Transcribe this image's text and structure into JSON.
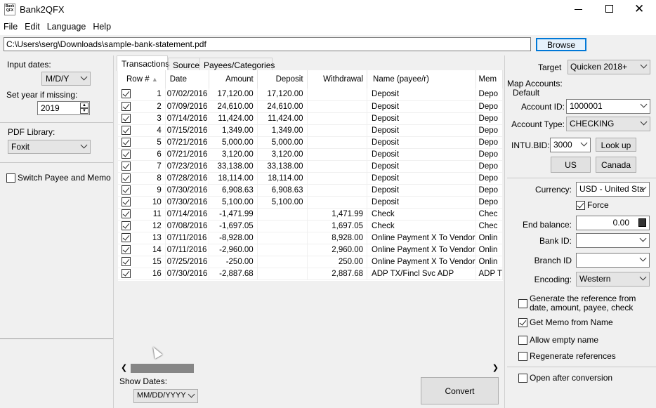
{
  "window": {
    "title": "Bank2QFX",
    "app_icon_text": "Bank QFX"
  },
  "menu": [
    "File",
    "Edit",
    "Language",
    "Help"
  ],
  "file_path": "C:\\Users\\serg\\Downloads\\sample-bank-statement.pdf",
  "browse_label": "Browse",
  "left": {
    "input_dates_label": "Input dates:",
    "input_dates_value": "M/D/Y",
    "set_year_label": "Set year if missing:",
    "year_value": "2019",
    "pdf_library_label": "PDF Library:",
    "pdf_library_value": "Foxit",
    "switch_label": "Switch Payee and Memo"
  },
  "tabs": [
    "Transactions",
    "Source",
    "Payees/Categories"
  ],
  "columns": [
    "Row #",
    "Date",
    "Amount",
    "Deposit",
    "Withdrawal",
    "Name (payee/r)",
    "Mem"
  ],
  "rows": [
    {
      "n": "1",
      "date": "07/02/2016",
      "amount": "17,120.00",
      "deposit": "17,120.00",
      "withdrawal": "",
      "name": "Deposit",
      "memo": "Depo"
    },
    {
      "n": "2",
      "date": "07/09/2016",
      "amount": "24,610.00",
      "deposit": "24,610.00",
      "withdrawal": "",
      "name": "Deposit",
      "memo": "Depo"
    },
    {
      "n": "3",
      "date": "07/14/2016",
      "amount": "11,424.00",
      "deposit": "11,424.00",
      "withdrawal": "",
      "name": "Deposit",
      "memo": "Depo"
    },
    {
      "n": "4",
      "date": "07/15/2016",
      "amount": "1,349.00",
      "deposit": "1,349.00",
      "withdrawal": "",
      "name": "Deposit",
      "memo": "Depo"
    },
    {
      "n": "5",
      "date": "07/21/2016",
      "amount": "5,000.00",
      "deposit": "5,000.00",
      "withdrawal": "",
      "name": "Deposit",
      "memo": "Depo"
    },
    {
      "n": "6",
      "date": "07/21/2016",
      "amount": "3,120.00",
      "deposit": "3,120.00",
      "withdrawal": "",
      "name": "Deposit",
      "memo": "Depo"
    },
    {
      "n": "7",
      "date": "07/23/2016",
      "amount": "33,138.00",
      "deposit": "33,138.00",
      "withdrawal": "",
      "name": "Deposit",
      "memo": "Depo"
    },
    {
      "n": "8",
      "date": "07/28/2016",
      "amount": "18,114.00",
      "deposit": "18,114.00",
      "withdrawal": "",
      "name": "Deposit",
      "memo": "Depo"
    },
    {
      "n": "9",
      "date": "07/30/2016",
      "amount": "6,908.63",
      "deposit": "6,908.63",
      "withdrawal": "",
      "name": "Deposit",
      "memo": "Depo"
    },
    {
      "n": "10",
      "date": "07/30/2016",
      "amount": "5,100.00",
      "deposit": "5,100.00",
      "withdrawal": "",
      "name": "Deposit",
      "memo": "Depo"
    },
    {
      "n": "11",
      "date": "07/14/2016",
      "amount": "-1,471.99",
      "deposit": "",
      "withdrawal": "1,471.99",
      "name": "Check",
      "memo": "Chec"
    },
    {
      "n": "12",
      "date": "07/08/2016",
      "amount": "-1,697.05",
      "deposit": "",
      "withdrawal": "1,697.05",
      "name": "Check",
      "memo": "Chec"
    },
    {
      "n": "13",
      "date": "07/11/2016",
      "amount": "-8,928.00",
      "deposit": "",
      "withdrawal": "8,928.00",
      "name": "Online Payment X To Vendor",
      "memo": "Onlin"
    },
    {
      "n": "14",
      "date": "07/11/2016",
      "amount": "-2,960.00",
      "deposit": "",
      "withdrawal": "2,960.00",
      "name": "Online Payment X To Vendor",
      "memo": "Onlin"
    },
    {
      "n": "15",
      "date": "07/25/2016",
      "amount": "-250.00",
      "deposit": "",
      "withdrawal": "250.00",
      "name": "Online Payment X To Vendor",
      "memo": "Onlin"
    },
    {
      "n": "16",
      "date": "07/30/2016",
      "amount": "-2,887.68",
      "deposit": "",
      "withdrawal": "2,887.68",
      "name": "ADP TX/Fincl Svc ADP",
      "memo": "ADP T"
    }
  ],
  "bottom": {
    "show_dates_label": "Show Dates:",
    "show_dates_value": "MM/DD/YYYY",
    "convert_label": "Convert"
  },
  "right": {
    "target_label": "Target",
    "target_value": "Quicken 2018+",
    "map_accounts_label": "Map Accounts:",
    "default_label": "Default",
    "account_id_label": "Account ID:",
    "account_id_value": "1000001",
    "account_type_label": "Account Type:",
    "account_type_value": "CHECKING",
    "intu_bid_label": "INTU.BID:",
    "intu_bid_value": "3000",
    "lookup_label": "Look up",
    "us_label": "US",
    "canada_label": "Canada",
    "currency_label": "Currency:",
    "currency_value": "USD - United Sta",
    "force_label": "Force",
    "end_balance_label": "End balance:",
    "end_balance_value": "0.00",
    "bank_id_label": "Bank ID:",
    "branch_id_label": "Branch ID",
    "encoding_label": "Encoding:",
    "encoding_value": "Western",
    "gen_ref_label": "Generate the reference from date, amount, payee, check",
    "get_memo_label": "Get Memo from Name",
    "allow_empty_label": "Allow empty name",
    "regen_label": "Regenerate references",
    "open_after_label": "Open after conversion"
  }
}
